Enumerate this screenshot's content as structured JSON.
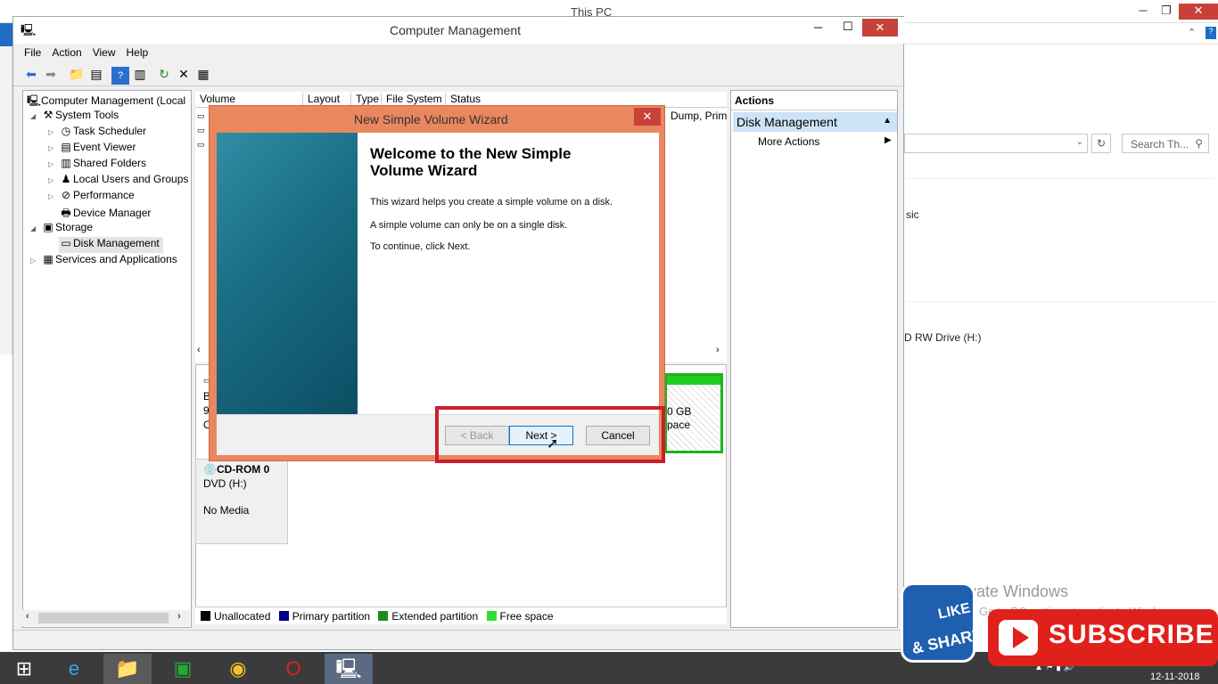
{
  "background_window": {
    "title": "This PC",
    "search_placeholder": "Search Th...",
    "item_partial_1": "sic",
    "item_partial_2": "D RW Drive (H:)",
    "watermark_line1": "Activate Windows",
    "watermark_line2": "Go to PC settings to activate Windows."
  },
  "computer_management": {
    "title": "Computer Management",
    "menu": [
      "File",
      "Action",
      "View",
      "Help"
    ],
    "tree": [
      {
        "label": "Computer Management (Local",
        "icon": "computer-icon"
      },
      {
        "label": "System Tools",
        "icon": "tools-icon"
      },
      {
        "label": "Task Scheduler",
        "icon": "clock-icon"
      },
      {
        "label": "Event Viewer",
        "icon": "event-icon"
      },
      {
        "label": "Shared Folders",
        "icon": "folder-icon"
      },
      {
        "label": "Local Users and Groups",
        "icon": "users-icon"
      },
      {
        "label": "Performance",
        "icon": "performance-icon"
      },
      {
        "label": "Device Manager",
        "icon": "device-icon"
      },
      {
        "label": "Storage",
        "icon": "storage-icon"
      },
      {
        "label": "Disk Management",
        "icon": "disk-icon"
      },
      {
        "label": "Services and Applications",
        "icon": "services-icon"
      }
    ],
    "columns": [
      "Volume",
      "Layout",
      "Type",
      "File System",
      "Status"
    ],
    "volume_status_partial": "Dump, Prim",
    "disk0_partial": [
      "B",
      "9",
      "O"
    ],
    "cdrom": {
      "name": "CD-ROM 0",
      "drive": "DVD (H:)",
      "media": "No Media"
    },
    "free_partial": [
      "0 GB",
      "pace"
    ],
    "legend": [
      {
        "label": "Unallocated",
        "color": "#000000"
      },
      {
        "label": "Primary partition",
        "color": "#00008b"
      },
      {
        "label": "Extended partition",
        "color": "#1a8c1a"
      },
      {
        "label": "Free space",
        "color": "#33dd33"
      }
    ],
    "actions": {
      "header": "Actions",
      "section": "Disk Management",
      "more": "More Actions"
    }
  },
  "wizard": {
    "title": "New Simple Volume Wizard",
    "heading": "Welcome to the New Simple Volume Wizard",
    "line1": "This wizard helps you create a simple volume on a disk.",
    "line2": "A simple volume can only be on a single disk.",
    "line3": "To continue, click Next.",
    "back": "< Back",
    "next": "Next >",
    "cancel": "Cancel"
  },
  "taskbar": {
    "date": "12-11-2018"
  },
  "overlays": {
    "like1": "LIKE",
    "like2": "& SHARE",
    "subscribe": "SUBSCRIBE"
  }
}
